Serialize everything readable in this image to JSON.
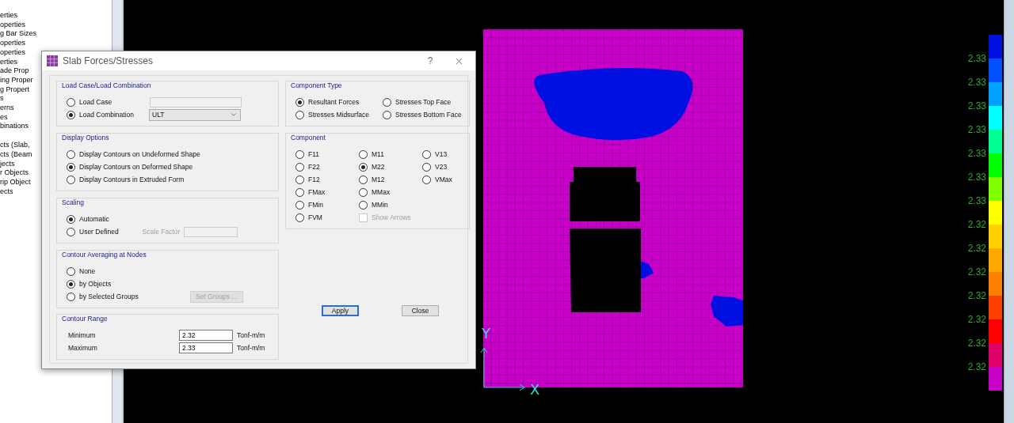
{
  "tree": {
    "groups": [
      [
        "erties",
        "operties",
        "g Bar Sizes",
        "operties",
        "operties",
        "erties",
        "ade Prop",
        "ing Proper",
        "g Propert",
        "s",
        "erns",
        "es",
        "binations"
      ],
      [
        "cts (Slab,",
        "cts (Beam",
        "jects",
        "r Objects",
        "rip Object",
        "ects"
      ]
    ]
  },
  "dialog": {
    "title": "Slab Forces/Stresses",
    "help": "?",
    "load_case": {
      "title": "Load Case/Load Combination",
      "options": [
        {
          "label": "Load Case",
          "selected": false,
          "kind": "field"
        },
        {
          "label": "Load Combination",
          "selected": true,
          "kind": "dropdown",
          "value": "ULT"
        }
      ]
    },
    "display_options": {
      "title": "Display Options",
      "options": [
        {
          "label": "Display Contours on Undeformed Shape",
          "selected": false
        },
        {
          "label": "Display Contours on Deformed Shape",
          "selected": true
        },
        {
          "label": "Display Contours in Extruded Form",
          "selected": false
        }
      ]
    },
    "scaling": {
      "title": "Scaling",
      "options": [
        {
          "label": "Automatic",
          "selected": true
        },
        {
          "label": "User Defined",
          "selected": false
        }
      ],
      "scale_factor": {
        "label": "Scale Factor",
        "disabled": true
      }
    },
    "contour_averaging": {
      "title": "Contour Averaging at Nodes",
      "options": [
        {
          "label": "None",
          "selected": false
        },
        {
          "label": "by Objects",
          "selected": true
        },
        {
          "label": "by Selected Groups",
          "selected": false
        }
      ],
      "set_groups_button": {
        "label": "Set Groups ...",
        "disabled": true
      }
    },
    "contour_range": {
      "title": "Contour Range",
      "rows": [
        {
          "label": "Minimum",
          "value": "2.32",
          "unit": "Tonf-m/m"
        },
        {
          "label": "Maximum",
          "value": "2.33",
          "unit": "Tonf-m/m"
        }
      ]
    },
    "component_type": {
      "title": "Component Type",
      "options": [
        {
          "label": "Resultant Forces",
          "selected": true
        },
        {
          "label": "Stresses Top Face",
          "selected": false
        },
        {
          "label": "Stresses Midsurface",
          "selected": false
        },
        {
          "label": "Stresses Bottom Face",
          "selected": false
        }
      ]
    },
    "component": {
      "title": "Component",
      "columns": [
        [
          {
            "kind": "radio",
            "label": "F11",
            "selected": false
          },
          {
            "kind": "radio",
            "label": "F22",
            "selected": false
          },
          {
            "kind": "radio",
            "label": "F12",
            "selected": false
          },
          {
            "kind": "radio",
            "label": "FMax",
            "selected": false
          },
          {
            "kind": "radio",
            "label": "FMin",
            "selected": false
          },
          {
            "kind": "radio",
            "label": "FVM",
            "selected": false
          }
        ],
        [
          {
            "kind": "radio",
            "label": "M11",
            "selected": false
          },
          {
            "kind": "radio",
            "label": "M22",
            "selected": true
          },
          {
            "kind": "radio",
            "label": "M12",
            "selected": false
          },
          {
            "kind": "radio",
            "label": "MMax",
            "selected": false
          },
          {
            "kind": "radio",
            "label": "MMin",
            "selected": false
          },
          {
            "kind": "checkbox",
            "label": "Show Arrows",
            "checked": false,
            "disabled": true
          }
        ],
        [
          {
            "kind": "radio",
            "label": "V13",
            "selected": false
          },
          {
            "kind": "radio",
            "label": "V23",
            "selected": false
          },
          {
            "kind": "radio",
            "label": "VMax",
            "selected": false
          }
        ]
      ]
    },
    "buttons": [
      {
        "label": "Apply",
        "default": true
      },
      {
        "label": "Close",
        "default": false
      }
    ]
  },
  "canvas": {
    "axis_labels": {
      "x": "X",
      "y": "Y"
    },
    "legend": {
      "swatches": [
        {
          "color": "#0010e0"
        },
        {
          "color": "#0050ff"
        },
        {
          "color": "#00a0ff"
        },
        {
          "color": "#00ffff"
        },
        {
          "color": "#00ff90"
        },
        {
          "color": "#00ff00"
        },
        {
          "color": "#80ff00"
        },
        {
          "color": "#ffff00"
        },
        {
          "color": "#ffd000"
        },
        {
          "color": "#ffa800"
        },
        {
          "color": "#ff8000"
        },
        {
          "color": "#ff4000"
        },
        {
          "color": "#ff0000"
        },
        {
          "color": "#e0006a"
        },
        {
          "color": "#c800c8"
        }
      ],
      "labels": [
        "2.33",
        "2.33",
        "2.33",
        "2.33",
        "2.33",
        "2.33",
        "2.33",
        "2.32",
        "2.32",
        "2.32",
        "2.32",
        "2.32",
        "2.32",
        "2.32"
      ]
    }
  }
}
